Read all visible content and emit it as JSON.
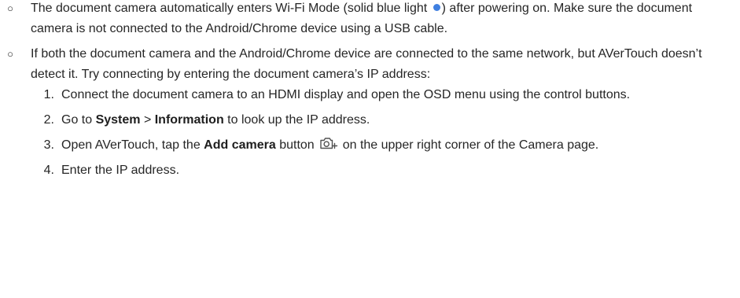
{
  "bullets": [
    {
      "mark": "○",
      "text_before": "The document camera automatically enters Wi-Fi Mode (solid blue light ",
      "led_color": "#3f7fe0",
      "text_after": ") after powering on. Make sure the document camera is not connected to the Android/Chrome device using a USB cable."
    },
    {
      "mark": "○",
      "text": "If both the document camera and the Android/Chrome device are connected to the same network, but AVerTouch doesn’t detect it. Try connecting by entering the document camera’s IP address:"
    }
  ],
  "steps": [
    {
      "num": "1.",
      "text": "Connect the document camera to an HDMI display and open the OSD menu using the control buttons."
    },
    {
      "num": "2.",
      "pre": "Go to ",
      "bold1": "System",
      "mid": " > ",
      "bold2": "Information",
      "post": " to look up the IP address."
    },
    {
      "num": "3.",
      "pre": "Open AVerTouch, tap the ",
      "bold": "Add camera",
      "mid": " button",
      "icon": "add-camera-icon",
      "post": "on the upper right corner of the Camera page."
    },
    {
      "num": "4.",
      "text": "Enter the IP address."
    }
  ]
}
